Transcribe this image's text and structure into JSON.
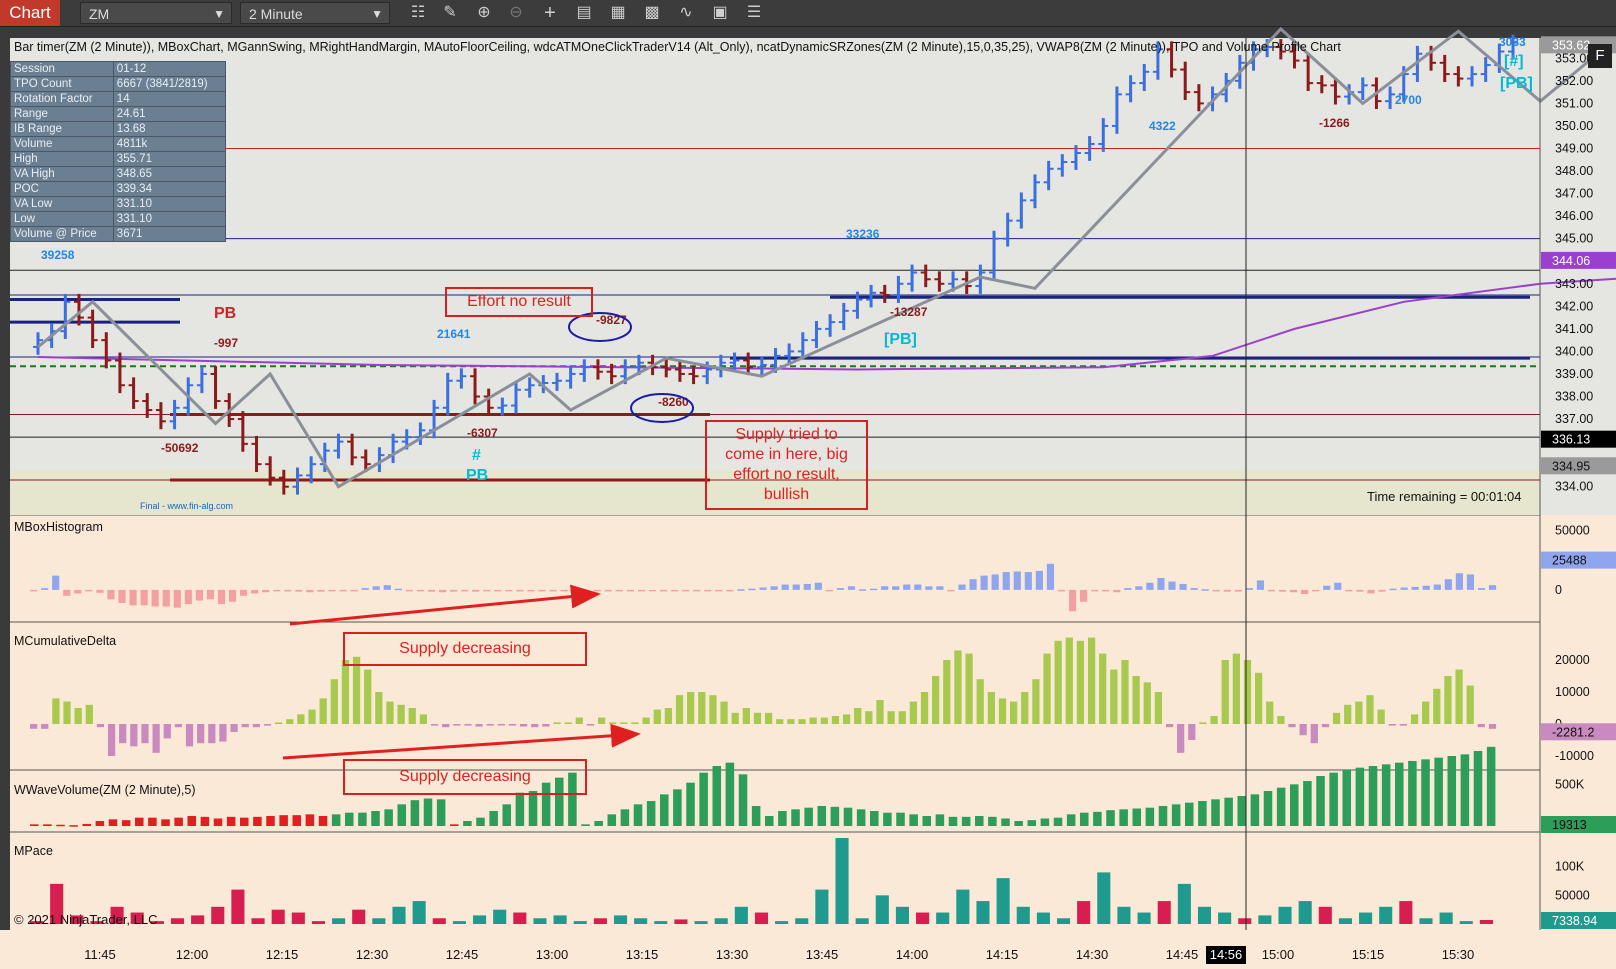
{
  "toolbar": {
    "chart_tab": "Chart",
    "instrument": "ZM",
    "interval": "2 Minute",
    "icons": [
      "bar-type-icon",
      "draw-pencil-icon",
      "zoom-in-icon",
      "zoom-out-icon",
      "crosshair-icon",
      "data-box-icon",
      "properties-icon",
      "strategies-icon",
      "indicators-icon",
      "templates-icon",
      "more-menu-icon"
    ]
  },
  "indicator_title": "Bar timer(ZM (2 Minute)), MBoxChart, MGannSwing, MRightHandMargin, MAutoFloorCeiling, wdcATMOneClickTraderV14 (Alt_Only), ncatDynamicSRZones(ZM (2 Minute),15,0,35,25), VWAP8(ZM (2 Minute)), TPO and Volume Profile Chart",
  "info_table": [
    {
      "label": "Session",
      "value": "01-12"
    },
    {
      "label": "TPO Count",
      "value": "6667 (3841/2819)"
    },
    {
      "label": "Rotation Factor",
      "value": "14"
    },
    {
      "label": "Range",
      "value": "24.61"
    },
    {
      "label": "IB Range",
      "value": "13.68"
    },
    {
      "label": "Volume",
      "value": "4811k"
    },
    {
      "label": "High",
      "value": "355.71"
    },
    {
      "label": "VA High",
      "value": "348.65"
    },
    {
      "label": "POC",
      "value": "339.34"
    },
    {
      "label": "VA Low",
      "value": "331.10"
    },
    {
      "label": "Low",
      "value": "331.10"
    },
    {
      "label": "Volume @ Price",
      "value": "3671"
    }
  ],
  "annotations": {
    "effort": "Effort no result",
    "supply_tried_lines": [
      "Supply tried to",
      "come in here, big",
      "effort no result,",
      "bullish"
    ],
    "supply_dec_1": "Supply decreasing",
    "supply_dec_2": "Supply decreasing"
  },
  "panes": {
    "histogram": "MBoxHistogram",
    "cumdelta": "MCumulativeDelta",
    "wavevol": "WWaveVolume(ZM (2 Minute),5)",
    "pace": "MPace"
  },
  "time_remaining": "Time remaining = 00:01:04",
  "copyright": "© 2021 NinjaTrader, LLC",
  "final_label": "Final - www.fin-alg.com",
  "window_button": "F",
  "colors": {
    "up": "#3b6fe0",
    "down": "#8b1a1a",
    "swing": "#8a8f99",
    "vwap": "#9a3fd0",
    "pane_bg": "#fbe9d7",
    "price_bg": "#e5e5e1",
    "hist_up": "#8fa6ee",
    "hist_down": "#f4a0a0",
    "cd_up": "#a6c94e",
    "cd_down": "#c98ac0",
    "wv_up": "#2d9e5a",
    "wv_down": "#e02020",
    "pace_up": "#1e9a8e",
    "pace_down": "#d81e4e"
  },
  "chart_data": {
    "type": "candlestick",
    "x_tick_labels": [
      "11:45",
      "12:00",
      "12:15",
      "12:30",
      "12:45",
      "13:00",
      "13:15",
      "13:30",
      "13:45",
      "14:00",
      "14:15",
      "14:30",
      "14:45",
      "14:56",
      "15:00",
      "15:15",
      "15:30"
    ],
    "crosshair_time": "14:56",
    "price_axis": {
      "ticks": [
        334,
        335,
        336,
        337,
        338,
        339,
        340,
        341,
        342,
        343,
        344,
        345,
        346,
        347,
        348,
        349,
        350,
        351,
        352,
        353
      ],
      "ylim": [
        333.1,
        353.9
      ],
      "current_price": 336.13,
      "vwap_marker": 344.06,
      "level_marker": 334.95,
      "top_marker": 353.62
    },
    "price_path": [
      340.5,
      340.9,
      342.2,
      341.5,
      340.5,
      339.6,
      338.5,
      337.8,
      337.4,
      336.9,
      337.5,
      338.5,
      339.0,
      337.8,
      337.0,
      335.9,
      335.0,
      334.4,
      334.0,
      334.5,
      335.0,
      335.6,
      336.0,
      335.3,
      335.0,
      335.4,
      336.0,
      336.2,
      336.5,
      337.5,
      338.7,
      338.9,
      338.0,
      337.5,
      337.6,
      338.3,
      338.5,
      338.6,
      338.7,
      339.0,
      339.3,
      339.1,
      338.9,
      339.3,
      339.5,
      339.3,
      339.2,
      339.0,
      338.9,
      339.2,
      339.5,
      339.6,
      339.3,
      339.4,
      339.8,
      340.0,
      340.5,
      341.0,
      341.3,
      341.8,
      342.3,
      342.6,
      342.5,
      343.0,
      343.5,
      343.2,
      343.0,
      343.2,
      342.9,
      343.5,
      345.0,
      345.8,
      346.7,
      347.5,
      348.1,
      348.4,
      348.8,
      349.2,
      350.0,
      351.4,
      351.9,
      352.4,
      353.4,
      352.5,
      351.5,
      351.0,
      351.4,
      352.0,
      352.8,
      353.4,
      353.5,
      353.3,
      352.9,
      351.9,
      351.8,
      351.3,
      351.5,
      351.8,
      351.1,
      351.4,
      352.3,
      353.2,
      352.8,
      352.3,
      352.1,
      352.3,
      352.7,
      353.3,
      353.7
    ],
    "swing_points": [
      [
        0,
        340.2
      ],
      [
        4,
        342.2
      ],
      [
        13,
        336.8
      ],
      [
        17,
        339.0
      ],
      [
        22,
        334.0
      ],
      [
        36,
        339.0
      ],
      [
        39,
        337.4
      ],
      [
        46,
        339.7
      ],
      [
        53,
        338.9
      ],
      [
        69,
        343.3
      ],
      [
        73,
        342.8
      ],
      [
        91,
        354.3
      ],
      [
        97,
        351.0
      ],
      [
        104,
        354.2
      ],
      [
        110,
        351.1
      ],
      [
        115,
        353.6
      ],
      [
        119,
        352.0
      ],
      [
        124,
        353.9
      ]
    ],
    "vwap_path": [
      [
        0,
        339.75
      ],
      [
        25,
        339.4
      ],
      [
        60,
        339.2
      ],
      [
        78,
        339.3
      ],
      [
        86,
        339.8
      ],
      [
        92,
        341.0
      ],
      [
        100,
        342.2
      ],
      [
        110,
        343.0
      ],
      [
        125,
        343.6
      ],
      [
        133,
        344.06
      ]
    ],
    "horizontal_levels": [
      {
        "price": 349.0,
        "color": "#d02020"
      },
      {
        "price": 345.0,
        "color": "#1a237e"
      },
      {
        "price": 343.6,
        "color": "#222"
      },
      {
        "price": 342.5,
        "color": "#1a237e"
      },
      {
        "price": 339.75,
        "color": "#1a237e"
      },
      {
        "price": 339.34,
        "color": "#1a7a1a"
      },
      {
        "price": 337.2,
        "color": "#8b1a1a"
      },
      {
        "price": 336.2,
        "color": "#222"
      },
      {
        "price": 334.3,
        "color": "#8b1a1a"
      }
    ],
    "swing_volume_labels": [
      {
        "text": "39258",
        "color": "#1e88e5"
      },
      {
        "text": "PB",
        "color": "#c62828"
      },
      {
        "text": "-997",
        "color": "#8b1a1a"
      },
      {
        "text": "-50692",
        "color": "#8b1a1a"
      },
      {
        "text": "21641",
        "color": "#1e88e5"
      },
      {
        "text": "-6307",
        "color": "#8b1a1a"
      },
      {
        "text": "#",
        "color": "#00bcd4"
      },
      {
        "text": "PB",
        "color": "#00bcd4"
      },
      {
        "text": "-9827",
        "color": "#8b1a1a"
      },
      {
        "text": "-8260",
        "color": "#8b1a1a"
      },
      {
        "text": "33236",
        "color": "#1e88e5"
      },
      {
        "text": "-13287",
        "color": "#8b1a1a"
      },
      {
        "text": "[PB]",
        "color": "#00bcd4"
      },
      {
        "text": "4322",
        "color": "#1e88e5"
      },
      {
        "text": "-1266",
        "color": "#8b1a1a"
      },
      {
        "text": "2700",
        "color": "#1e88e5"
      },
      {
        "text": "3033",
        "color": "#1e88e5"
      },
      {
        "text": "[#]",
        "color": "#00bcd4"
      },
      {
        "text": "[PB]",
        "color": "#00bcd4"
      }
    ],
    "histogram": {
      "ticks": [
        "50000",
        "0"
      ],
      "ylim": [
        -22000,
        58000
      ],
      "current": "25488",
      "values": [
        -1000,
        1500,
        12000,
        -5000,
        -3000,
        -1000,
        -2500,
        -8000,
        -11000,
        -13000,
        -13000,
        -14000,
        -14000,
        -15000,
        -12000,
        -9000,
        -8000,
        -12000,
        -10000,
        -5000,
        -3000,
        -2000,
        -1000,
        -1000,
        -1500,
        -2000,
        -1500,
        -1000,
        -1000,
        -500,
        1500,
        3000,
        4000,
        1000,
        -500,
        -1000,
        -1500,
        -2000,
        -1500,
        -1000,
        -1500,
        -800,
        -500,
        -300,
        -500,
        -300,
        -500,
        -300,
        -800,
        -500,
        -300,
        -200,
        -300,
        -500,
        -300,
        -200,
        -300,
        -200,
        -300,
        -500,
        -400,
        -200,
        -300,
        -200,
        500,
        1000,
        2000,
        3000,
        4500,
        4500,
        5000,
        6000,
        -1000,
        1500,
        3000,
        500,
        1000,
        3000,
        3000,
        4500,
        4500,
        3000,
        3000,
        -1000,
        4500,
        9000,
        12000,
        13000,
        15000,
        15500,
        15000,
        16000,
        22000,
        -500,
        -18000,
        -10000,
        -1000,
        -1000,
        -2000,
        1500,
        3000,
        6000,
        10000,
        7000,
        5000,
        1500,
        500,
        -1000,
        -1500,
        -1500,
        1500,
        8000,
        -500,
        -1500,
        -2000,
        -3500,
        -1000,
        3500,
        6000,
        -1000,
        -1500,
        -3000,
        -1500,
        1000,
        2000,
        2500,
        3500,
        4500,
        9000,
        14000,
        13000,
        1500,
        4000
      ],
      "up_color": "#8fa6ee",
      "down_color": "#f4a0a0"
    },
    "cumulative_delta": {
      "ticks": [
        "20000",
        "10000",
        "0",
        "-10000"
      ],
      "ylim": [
        -12500,
        30000
      ],
      "current": "-2281.2",
      "values": [
        -1500,
        -1500,
        8000,
        7000,
        5000,
        6000,
        -1000,
        -10000,
        -6000,
        -7000,
        -6000,
        -9000,
        -4500,
        -1000,
        -7000,
        -6000,
        -6000,
        -5500,
        -2500,
        -1000,
        -1000,
        -500,
        500,
        1500,
        3000,
        4500,
        8000,
        14000,
        20000,
        21000,
        17000,
        10000,
        7000,
        6000,
        5000,
        3000,
        -500,
        -1000,
        -500,
        -500,
        -800,
        -500,
        -300,
        -500,
        -800,
        -1000,
        -800,
        500,
        500,
        2000,
        -500,
        2000,
        500,
        500,
        500,
        2000,
        4500,
        5000,
        9000,
        10000,
        10000,
        9000,
        7000,
        3500,
        5000,
        3500,
        3500,
        1500,
        1500,
        1500,
        2000,
        2000,
        2500,
        3000,
        5000,
        4000,
        7500,
        4000,
        4000,
        7000,
        10000,
        15000,
        20000,
        23000,
        22000,
        14000,
        10000,
        8000,
        7000,
        10000,
        14000,
        22000,
        26000,
        27000,
        26000,
        27000,
        22000,
        17000,
        20000,
        15000,
        13000,
        10000,
        -1000,
        -9000,
        -5000,
        500,
        2500,
        20000,
        22000,
        20000,
        16000,
        7000,
        2500,
        -1000,
        -3500,
        -6000,
        -1000,
        3500,
        6000,
        7000,
        9000,
        4500,
        -500,
        -500,
        3000,
        7000,
        11000,
        15000,
        17000,
        12000,
        -1000,
        -1500
      ],
      "up_color": "#a6c94e",
      "down_color": "#c98ac0"
    },
    "wave_volume": {
      "ticks": [
        "500K"
      ],
      "ylim": [
        0,
        600000
      ],
      "current": "19313",
      "values": [
        20000,
        20000,
        15000,
        10000,
        25000,
        60000,
        80000,
        70000,
        100000,
        100000,
        80000,
        100000,
        120000,
        110000,
        90000,
        110000,
        100000,
        110000,
        120000,
        130000,
        130000,
        140000,
        120000,
        140000,
        160000,
        160000,
        180000,
        200000,
        260000,
        310000,
        330000,
        320000,
        20000,
        60000,
        100000,
        180000,
        260000,
        400000,
        420000,
        520000,
        580000,
        640000,
        20000,
        60000,
        140000,
        200000,
        260000,
        300000,
        380000,
        440000,
        520000,
        640000,
        720000,
        760000,
        620000,
        240000,
        120000,
        180000,
        200000,
        220000,
        240000,
        230000,
        220000,
        200000,
        180000,
        160000,
        160000,
        140000,
        120000,
        140000,
        110000,
        110000,
        120000,
        110000,
        90000,
        60000,
        70000,
        90000,
        100000,
        140000,
        160000,
        170000,
        190000,
        200000,
        210000,
        220000,
        240000,
        260000,
        280000,
        300000,
        320000,
        340000,
        360000,
        380000,
        420000,
        460000,
        500000,
        540000,
        600000,
        640000,
        680000,
        700000,
        720000,
        740000,
        760000,
        780000,
        800000,
        820000,
        840000,
        860000,
        900000,
        950000
      ],
      "up_color": "#2d9e5a",
      "down_color": "#e02020"
    },
    "pace": {
      "ticks": [
        "100K",
        "50000"
      ],
      "ylim": [
        0,
        150000
      ],
      "current": "7338.94",
      "values": [
        5000,
        70000,
        15000,
        5000,
        30000,
        20000,
        5000,
        10000,
        15000,
        30000,
        60000,
        10000,
        25000,
        20000,
        5000,
        10000,
        25000,
        10000,
        30000,
        40000,
        10000,
        5000,
        15000,
        25000,
        20000,
        10000,
        15000,
        5000,
        10000,
        15000,
        10000,
        5000,
        8000,
        5000,
        10000,
        30000,
        20000,
        5000,
        10000,
        60000,
        150000,
        10000,
        50000,
        30000,
        20000,
        20000,
        60000,
        40000,
        80000,
        30000,
        20000,
        10000,
        40000,
        90000,
        30000,
        20000,
        40000,
        70000,
        30000,
        20000,
        10000,
        15000,
        30000,
        40000,
        30000,
        10000,
        20000,
        30000,
        40000,
        10000,
        20000,
        5000,
        7000
      ],
      "up_color": "#1e9a8e",
      "down_color": "#d81e4e"
    }
  }
}
